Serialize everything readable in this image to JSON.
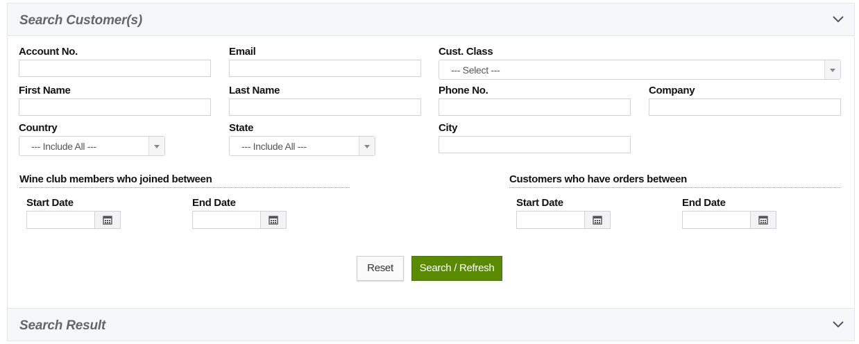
{
  "search_panel": {
    "title": "Search Customer(s)",
    "fields": {
      "account_no": {
        "label": "Account No.",
        "value": ""
      },
      "email": {
        "label": "Email",
        "value": ""
      },
      "cust_class": {
        "label": "Cust. Class",
        "selected": "--- Select ---"
      },
      "first_name": {
        "label": "First Name",
        "value": ""
      },
      "last_name": {
        "label": "Last Name",
        "value": ""
      },
      "phone_no": {
        "label": "Phone No.",
        "value": ""
      },
      "company": {
        "label": "Company",
        "value": ""
      },
      "country": {
        "label": "Country",
        "selected": "--- Include All ---"
      },
      "state": {
        "label": "State",
        "selected": "--- Include All ---"
      },
      "city": {
        "label": "City",
        "value": ""
      }
    },
    "wine_club": {
      "heading": "Wine club members who joined between",
      "start_label": "Start Date",
      "end_label": "End Date"
    },
    "orders": {
      "heading": "Customers who have orders between",
      "start_label": "Start Date",
      "end_label": "End Date"
    },
    "buttons": {
      "reset": "Reset",
      "search": "Search / Refresh"
    }
  },
  "result_panel": {
    "title": "Search Result"
  },
  "icons": {
    "collapse": "chevron-down-icon",
    "calendar": "calendar-icon"
  },
  "colors": {
    "primary_button": "#5a8a00",
    "header_bg": "#f6f7f9"
  }
}
